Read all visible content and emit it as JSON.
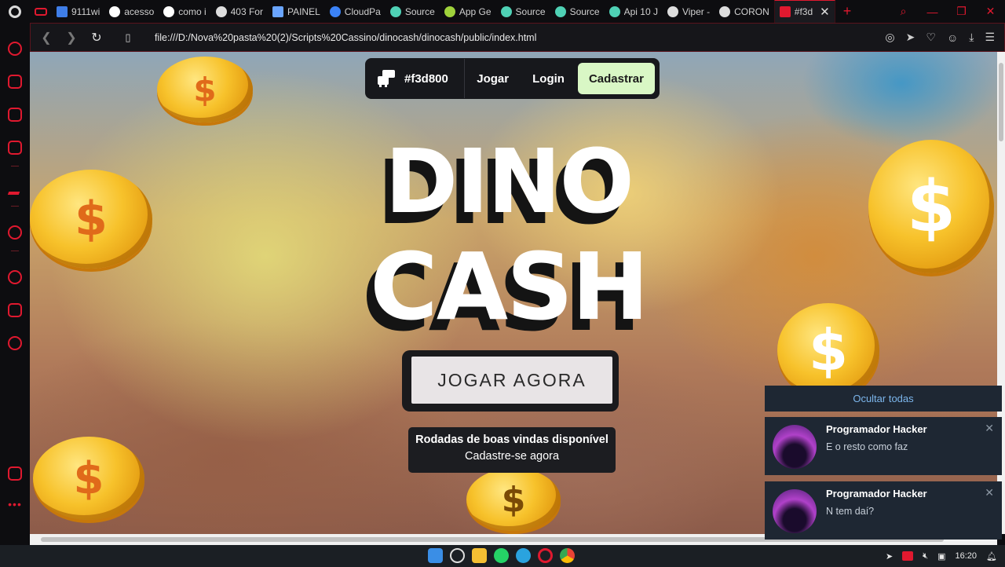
{
  "browser": {
    "tabs": [
      {
        "label": "",
        "icon": "gamepad-icon",
        "color": "#e0192f"
      },
      {
        "label": "9111wi",
        "icon": "site-icon",
        "color": "#3f7ee8"
      },
      {
        "label": "acesso",
        "icon": "google-icon",
        "color": "#ffffff"
      },
      {
        "label": "como i",
        "icon": "google-icon",
        "color": "#ffffff"
      },
      {
        "label": "403 For",
        "icon": "globe-icon",
        "color": "#dddddd"
      },
      {
        "label": "PAINEL",
        "icon": "bolt-icon",
        "color": "#6aa5ff"
      },
      {
        "label": "CloudPa",
        "icon": "cloud-icon",
        "color": "#3b82f6"
      },
      {
        "label": "Source",
        "icon": "source-icon",
        "color": "#4fd1b5"
      },
      {
        "label": "App Ge",
        "icon": "app-icon",
        "color": "#9fd23b"
      },
      {
        "label": "Source",
        "icon": "source-icon",
        "color": "#4fd1b5"
      },
      {
        "label": "Source",
        "icon": "source-icon",
        "color": "#4fd1b5"
      },
      {
        "label": "Api 10 J",
        "icon": "source-icon",
        "color": "#4fd1b5"
      },
      {
        "label": "Viper -",
        "icon": "globe-icon",
        "color": "#dddddd"
      },
      {
        "label": "CORON",
        "icon": "globe-icon",
        "color": "#dddddd"
      }
    ],
    "active_tab": {
      "label": "#f3d",
      "icon": "dino-icon",
      "color": "#e0192f"
    },
    "url": "file:///D:/Nova%20pasta%20(2)/Scripts%20Cassino/dinocash/dinocash/public/index.html",
    "accent": "#e0192f"
  },
  "page": {
    "brand": "#f3d800",
    "nav": {
      "play": "Jogar",
      "login": "Login",
      "signup": "Cadastrar"
    },
    "title_line1": "DINO",
    "title_line2": "CASH",
    "play_button": "JOGAR AGORA",
    "promo_line1": "Rodadas de boas vindas disponível",
    "promo_line2": "Cadastre-se agora",
    "signup_color": "#d9f7c5"
  },
  "notifications": {
    "hide_all": "Ocultar todas",
    "items": [
      {
        "title": "Programador Hacker",
        "message": "E o resto como faz"
      },
      {
        "title": "Programador Hacker",
        "message": "N tem daí?"
      }
    ]
  },
  "taskbar": {
    "time": "16:20"
  }
}
